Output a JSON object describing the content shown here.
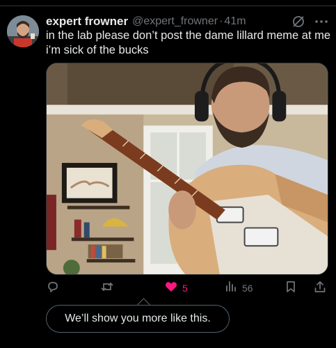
{
  "tweet": {
    "display_name": "expert frowner",
    "handle": "@expert_frowner",
    "separator": "·",
    "time": "41m",
    "text": "in the lab please don’t post the dame lillard meme at me\ni’m sick of the bucks"
  },
  "icons": {
    "grok": "grok-icon",
    "more": "more-icon",
    "reply": "reply-icon",
    "retweet": "retweet-icon",
    "like": "heart-icon",
    "views": "views-icon",
    "bookmark": "bookmark-icon",
    "share": "share-icon"
  },
  "actions": {
    "reply_count": "",
    "retweet_count": "",
    "like_count": "5",
    "views_count": "56"
  },
  "feedback": {
    "message": "We’ll show you more like this."
  },
  "colors": {
    "background": "#000000",
    "text": "#e7e9ea",
    "muted": "#71767b",
    "accent": "#1d9bf0",
    "like": "#f91880"
  }
}
